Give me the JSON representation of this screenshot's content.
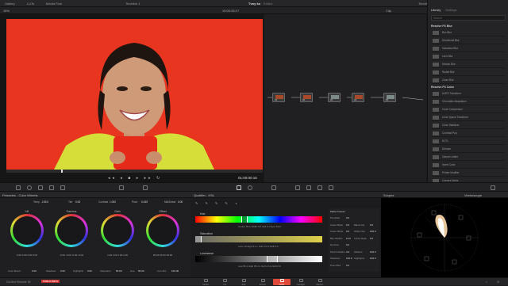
{
  "topbar": {
    "left": [
      "Gallery",
      "LUTs",
      "Media Pool"
    ],
    "timeline_title": "Timeline 1",
    "project_title": "Tvoy ko",
    "edited": "Edited",
    "right": [
      "Timeline",
      "Nodes",
      "Effects",
      "Lightbox"
    ]
  },
  "subbar": {
    "zoom": "16%",
    "timecode": "10:00:26:17",
    "clip_label": "Clip"
  },
  "viewer": {
    "timecode": "01:00:00:16"
  },
  "library": {
    "tabs": [
      "Library",
      "Settings"
    ],
    "search_placeholder": "Search",
    "section_blur": "Resolve FX Blur",
    "blur_items": [
      "Box Blur",
      "Directional Blur",
      "Gaussian Blur",
      "Lens Blur",
      "Mosaic Blur",
      "Radial Blur",
      "Zoom Blur"
    ],
    "section_color": "Resolve FX Color",
    "color_items": [
      "ACES Transform",
      "Chromatic Adaptation",
      "Color Compressor",
      "Color Space Transform",
      "Color Stabilizer",
      "Contrast Pop",
      "DCTL",
      "Dehaze",
      "Gamut Limiter",
      "Invert Color",
      "Printer Modifier",
      "Camera Noise"
    ]
  },
  "nodes": [
    "01",
    "02",
    "03",
    "04",
    "05"
  ],
  "primaries": {
    "title": "Primaries - Color Wheels",
    "temp_label": "Temp",
    "temp_value": "-193.0",
    "tint_label": "Tint",
    "tint_value": "0.00",
    "contrast_label": "Contrast",
    "contrast_value": "1.000",
    "pivot_label": "Pivot",
    "pivot_value": "0.435",
    "middetail_label": "Mid/Detail",
    "middetail_value": "0.00",
    "wheels": [
      {
        "label": "Lift",
        "values": "0.00  0.00  0.00  0.00"
      },
      {
        "label": "Gamma",
        "values": "-0.00  -0.00  -0.00  -0.00"
      },
      {
        "label": "Gain",
        "values": "1.00  1.00  1.00  1.00"
      },
      {
        "label": "Offset",
        "values": "25.00  25.00  25.00"
      }
    ],
    "footer": [
      {
        "label": "Color Boost",
        "value": "0.00"
      },
      {
        "label": "Shadows",
        "value": "0.00"
      },
      {
        "label": "Highlights",
        "value": "0.00"
      },
      {
        "label": "Saturation",
        "value": "50.00"
      },
      {
        "label": "Hue",
        "value": "50.00"
      },
      {
        "label": "Lum Mix",
        "value": "100.00"
      }
    ]
  },
  "qualifier": {
    "title": "Qualifier - HSL",
    "hue_label": "Hue",
    "hue_values": "Center 99.1   Width 6.0   Soft 6.0   Sym 50.0",
    "sat_label": "Saturation",
    "sat_values": "Low 1.6   High 9.1   L.Soft 0.0   H.Soft 0.0",
    "lum_label": "Luminance",
    "lum_values": "Low 56.1   High 65.4   L.Soft 2.4   H.Soft 0.0"
  },
  "matte": {
    "title": "Matte Finesse",
    "rows": [
      [
        "Pre-Filter",
        "0.0",
        "",
        ""
      ],
      [
        "Clean Black",
        "0.0",
        "Black Clip",
        "0.0"
      ],
      [
        "Clean White",
        "0.0",
        "White Clip",
        "100.0"
      ],
      [
        "Blur Radius",
        "19.0",
        "In/Out Ratio",
        "0.0"
      ],
      [
        "Denoise",
        "0.0",
        "",
        ""
      ],
      [
        "Morph Radius",
        "0.0",
        "Midtone",
        "100.0"
      ],
      [
        "Shadows",
        "100.0",
        "Highlights",
        "100.0"
      ],
      [
        "Post-Filter",
        "0.0",
        "",
        ""
      ]
    ]
  },
  "scopes": {
    "title": "Scopes",
    "mode": "Vectorscope"
  },
  "bottombar": {
    "app": "DaVinci Resolve 18",
    "badge": "PUBLIC BETA",
    "pages": [
      "Media",
      "Cut",
      "Edit",
      "Fusion",
      "Color",
      "Fairlight",
      "Deliver"
    ],
    "active_page": "Color"
  },
  "colors": {
    "accent": "#e04a3a",
    "background": "#e8351f",
    "jacket": "#d8e23a"
  }
}
